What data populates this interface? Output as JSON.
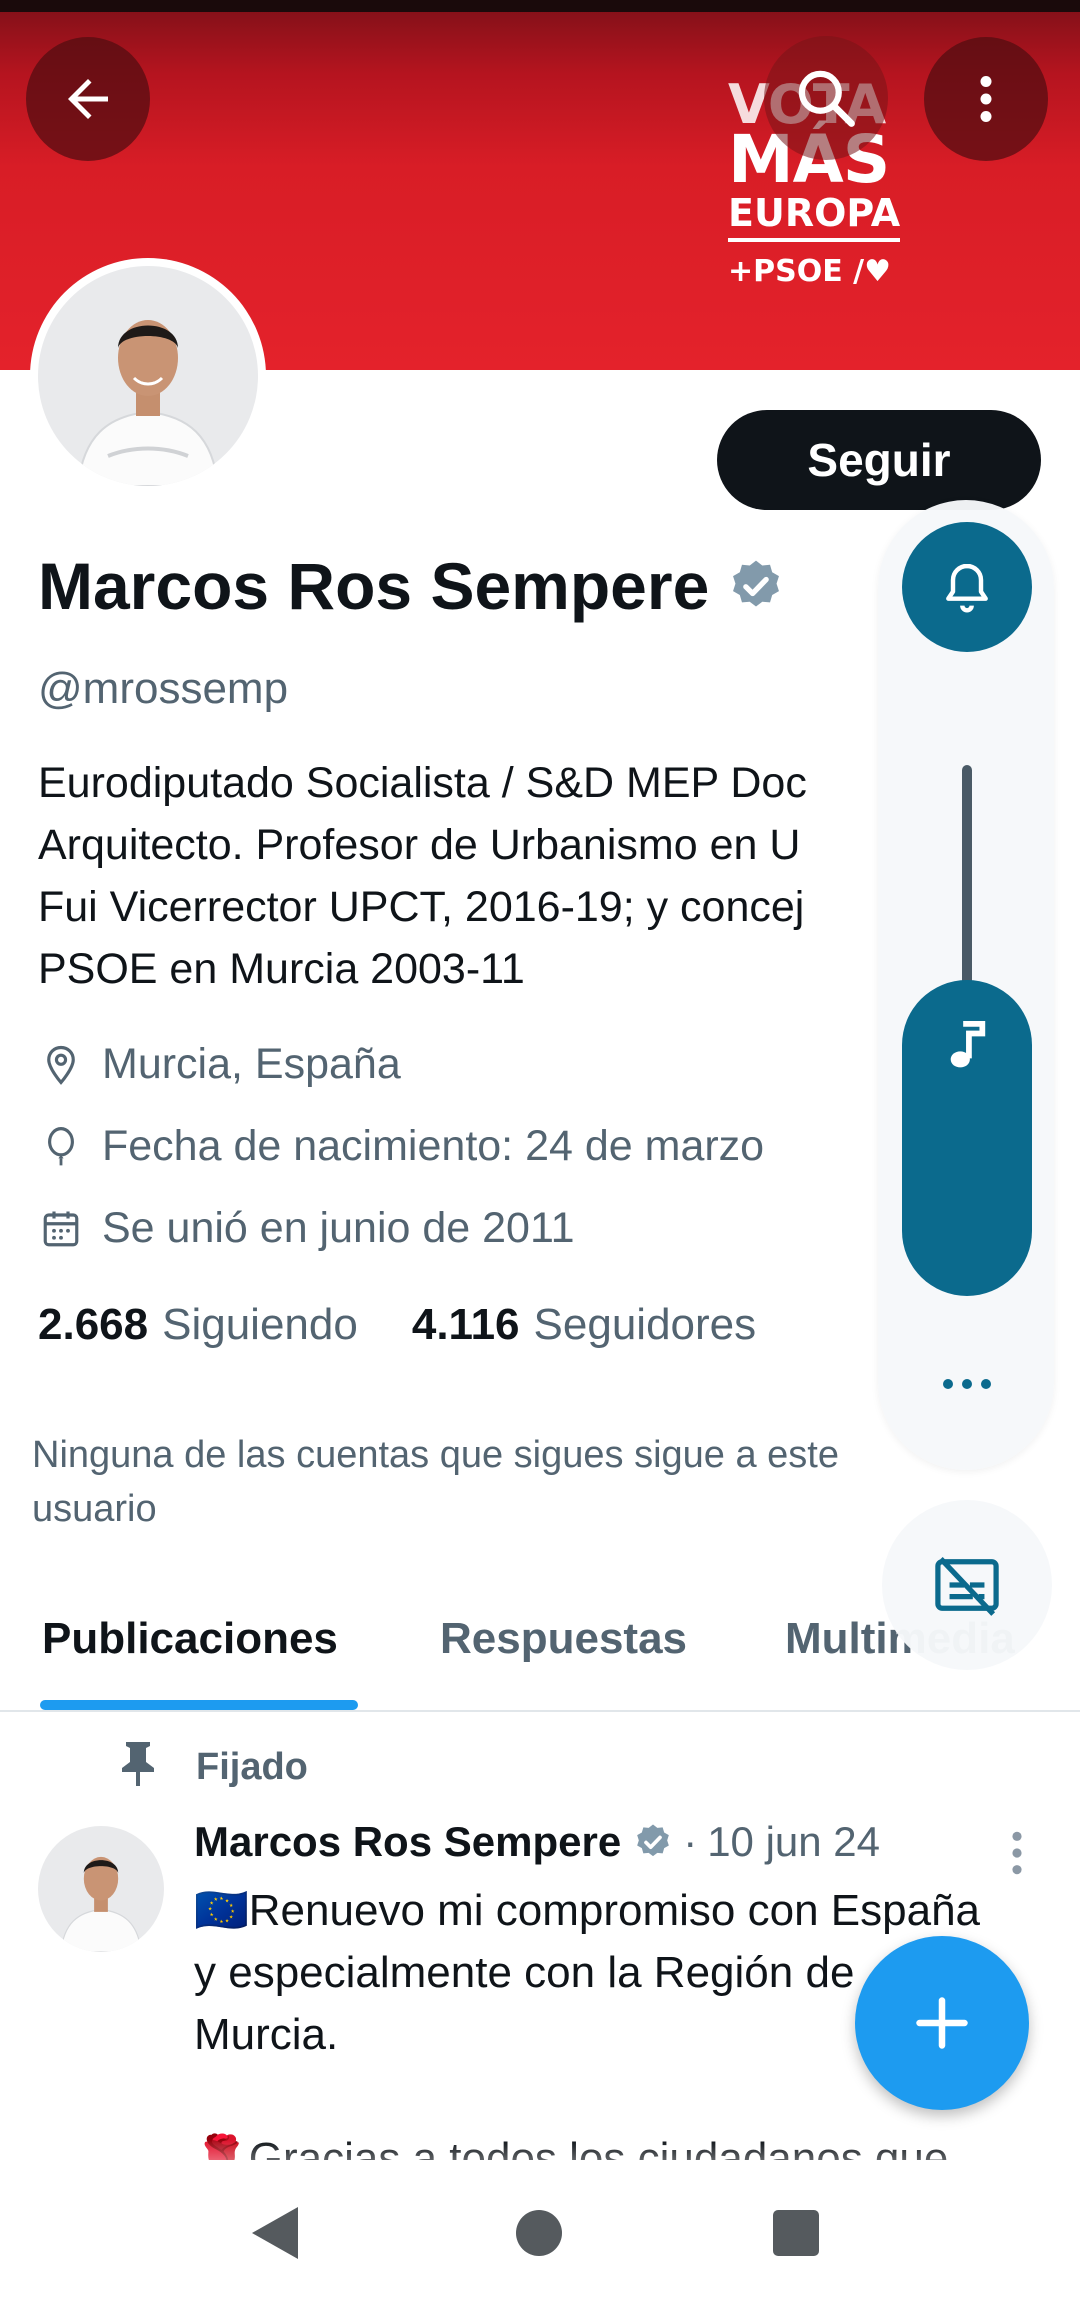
{
  "banner": {
    "campaign_line1": "VOTA",
    "campaign_line2": "MÁS",
    "campaign_line3": "EUROPA",
    "campaign_line4": "+PSOE /♥",
    "background_color": "#e4222b"
  },
  "header": {
    "back_icon": "arrow-left-icon",
    "search_icon": "search-icon",
    "more_icon": "more-vertical-icon"
  },
  "profile": {
    "follow_label": "Seguir",
    "name": "Marcos Ros Sempere",
    "handle": "@mrossemp",
    "bio_lines": [
      "Eurodiputado Socialista / S&D MEP Doc",
      "Arquitecto. Profesor de Urbanismo en U",
      "Fui Vicerrector UPCT, 2016-19; y concej",
      "PSOE en Murcia 2003-11"
    ],
    "location": "Murcia, España",
    "birth": "Fecha de nacimiento: 24 de marzo",
    "joined": "Se unió en junio de 2011",
    "following_count": "2.668",
    "following_label": "Siguiendo",
    "followers_count": "4.116",
    "followers_label": "Seguidores",
    "no_mutuals": "Ninguna de las cuentas que sigues sigue a este usuario"
  },
  "tabs": [
    {
      "label": "Publicaciones",
      "active": true
    },
    {
      "label": "Respuestas",
      "active": false
    },
    {
      "label": "Multimedia",
      "active": false
    }
  ],
  "tweet": {
    "pinned_label": "Fijado",
    "author": "Marcos Ros Sempere",
    "separator": "·",
    "date": "10 jun 24",
    "lines": [
      "🇪🇺Renuevo mi compromiso con España",
      "y especialmente con la Región de",
      "Murcia.",
      "🌹Gracias a todos los ciudadanos que"
    ]
  },
  "volume_overlay": {
    "ring_icon": "bell-icon",
    "media_icon": "music-note-icon",
    "more_icon": "more-horizontal-icon",
    "caption_icon": "captions-off-icon",
    "media_level": 0.37,
    "accent_color": "#0b6a8d"
  },
  "fab": {
    "icon": "plus-icon",
    "color": "#1d9bf0"
  },
  "navbar": {
    "back_icon": "nav-back-icon",
    "home_icon": "nav-home-icon",
    "recents_icon": "nav-recents-icon"
  },
  "colors": {
    "accent": "#1d9bf0",
    "text": "#0f1419",
    "secondary": "#536471"
  }
}
